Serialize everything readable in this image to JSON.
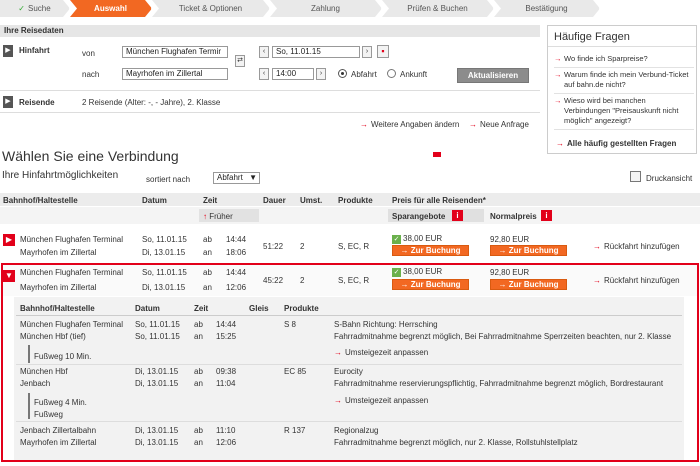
{
  "steps": [
    {
      "label": "Suche",
      "state": "done"
    },
    {
      "label": "Auswahl",
      "state": "active"
    },
    {
      "label": "Ticket & Optionen",
      "state": "todo"
    },
    {
      "label": "Zahlung",
      "state": "todo"
    },
    {
      "label": "Prüfen & Buchen",
      "state": "todo"
    },
    {
      "label": "Bestätigung",
      "state": "todo"
    }
  ],
  "reisedaten": {
    "header": "Ihre Reisedaten",
    "hinfahrt_label": "Hinfahrt",
    "von_label": "von",
    "nach_label": "nach",
    "von_value": "München Flughafen Termir",
    "nach_value": "Mayrhofen im Zillertal",
    "date_value": "So, 11.01.15",
    "time_value": "14:00",
    "abfahrt_label": "Abfahrt",
    "ankunft_label": "Ankunft",
    "aktualisieren_label": "Aktualisieren",
    "reisende_label": "Reisende",
    "reisende_value": "2 Reisende (Alter: -, - Jahre), 2. Klasse",
    "weitere_label": "Weitere Angaben ändern",
    "neue_anfrage_label": "Neue Anfrage"
  },
  "faq": {
    "title": "Häufige Fragen",
    "items": [
      "Wo finde ich Sparpreise?",
      "Warum finde ich mein Verbund-Ticket auf bahn.de nicht?",
      "Wieso wird bei manchen Verbindungen \"Preisauskunft nicht möglich\" angezeigt?"
    ],
    "all_label": "Alle häufig gestellten Fragen"
  },
  "main": {
    "title": "Wählen Sie eine Verbindung",
    "subtitle": "Ihre Hinfahrtmöglichkeiten",
    "sortiert_label": "sortiert nach",
    "sort_value": "Abfahrt",
    "druck_label": "Druckansicht"
  },
  "table": {
    "headers": {
      "station": "Bahnhof/Haltestelle",
      "datum": "Datum",
      "zeit": "Zeit",
      "dauer": "Dauer",
      "umst": "Umst.",
      "produkte": "Produkte",
      "preis": "Preis für alle Reisenden*",
      "spar": "Sparangebote",
      "normal": "Normalpreis",
      "frueher": "Früher"
    },
    "rows": [
      {
        "from": "München Flughafen Terminal",
        "to": "Mayrhofen im Zillertal",
        "date_dep": "So, 11.01.15",
        "date_arr": "Di, 13.01.15",
        "ab": "ab",
        "an": "an",
        "time_dep": "14:44",
        "time_arr": "18:06",
        "dauer": "51:22",
        "umst": "2",
        "produkte": "S, EC, R",
        "spar_price": "38,00 EUR",
        "normal_price": "92,80 EUR",
        "buchung": "Zur Buchung",
        "rueckfahrt": "Rückfahrt hinzufügen"
      },
      {
        "from": "München Flughafen Terminal",
        "to": "Mayrhofen im Zillertal",
        "date_dep": "So, 11.01.15",
        "date_arr": "Di, 13.01.15",
        "ab": "ab",
        "an": "an",
        "time_dep": "14:44",
        "time_arr": "12:06",
        "dauer": "45:22",
        "umst": "2",
        "produkte": "S, EC, R",
        "spar_price": "38,00 EUR",
        "normal_price": "92,80 EUR",
        "buchung": "Zur Buchung",
        "rueckfahrt": "Rückfahrt hinzufügen"
      }
    ]
  },
  "details": {
    "headers": {
      "station": "Bahnhof/Haltestelle",
      "datum": "Datum",
      "zeit": "Zeit",
      "gleis": "Gleis",
      "produkte": "Produkte"
    },
    "legs": [
      {
        "from": "München Flughafen Terminal",
        "to": "München Hbf (tief)",
        "date1": "So, 11.01.15",
        "date2": "So, 11.01.15",
        "ab": "ab",
        "an": "an",
        "t1": "14:44",
        "t2": "15:25",
        "product": "S 8",
        "info1": "S-Bahn Richtung: Herrsching",
        "info2": "Fahrradmitnahme begrenzt möglich, Bei Fahrradmitnahme Sperrzeiten beachten, nur 2. Klasse"
      },
      {
        "from": "München Hbf",
        "to": "Jenbach",
        "date1": "Di, 13.01.15",
        "date2": "Di, 13.01.15",
        "ab": "ab",
        "an": "an",
        "t1": "09:38",
        "t2": "11:04",
        "product": "EC 85",
        "info1": "Eurocity",
        "info2": "Fahrradmitnahme reservierungspflichtig, Fahrradmitnahme begrenzt möglich, Bordrestaurant"
      },
      {
        "from": "Jenbach Zillertalbahn",
        "to": "Mayrhofen im Zillertal",
        "date1": "Di, 13.01.15",
        "date2": "Di, 13.01.15",
        "ab": "ab",
        "an": "an",
        "t1": "11:10",
        "t2": "12:06",
        "product": "R 137",
        "info1": "Regionalzug",
        "info2": "Fahrradmitnahme begrenzt möglich, nur 2. Klasse, Rollstuhlstellplatz"
      }
    ],
    "walk1": "Fußweg  10 Min.",
    "walk2a": "Fußweg  4 Min.",
    "walk2b": "Fußweg",
    "umsteige": "Umsteigezeit anpassen"
  },
  "colors": {
    "accent": "#f26822",
    "red": "#e2001a"
  }
}
